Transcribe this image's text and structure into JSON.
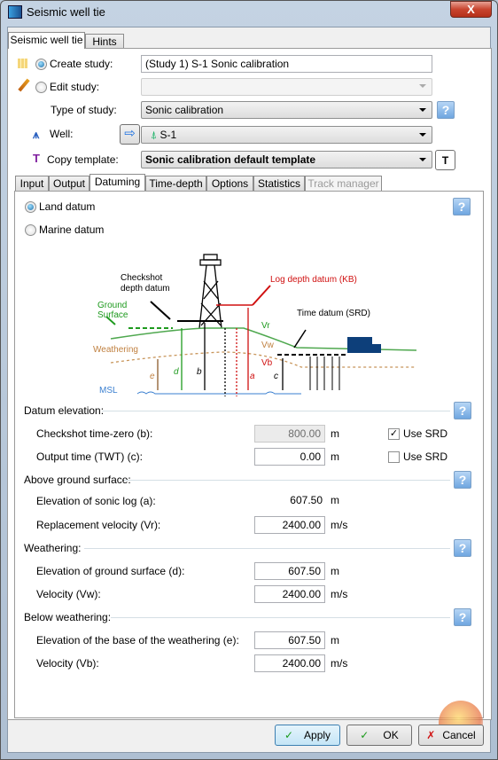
{
  "window": {
    "title": "Seismic well tie",
    "close_label": "X"
  },
  "outer_tabs": [
    {
      "label": "Seismic well tie",
      "active": true
    },
    {
      "label": "Hints",
      "active": false
    }
  ],
  "study": {
    "create_label": "Create study:",
    "create_value": "(Study 1) S-1 Sonic calibration",
    "create_selected": true,
    "edit_label": "Edit study:",
    "edit_value": "",
    "type_label": "Type of study:",
    "type_value": "Sonic calibration",
    "well_label": "Well:",
    "well_value": "S-1",
    "template_label": "Copy template:",
    "template_value": "Sonic calibration default template",
    "help_label": "?"
  },
  "inner_tabs": [
    {
      "label": "Input"
    },
    {
      "label": "Output"
    },
    {
      "label": "Datuming",
      "active": true
    },
    {
      "label": "Time-depth"
    },
    {
      "label": "Options"
    },
    {
      "label": "Statistics"
    },
    {
      "label": "Track manager",
      "disabled": true
    }
  ],
  "datum": {
    "land_label": "Land datum",
    "marine_label": "Marine datum",
    "selected": "land"
  },
  "diagram": {
    "checkshot": "Checkshot",
    "checkshot2": "depth datum",
    "ground": "Ground",
    "surface": "Surface",
    "log": "Log depth datum (KB)",
    "time": "Time datum (SRD)",
    "weathering": "Weathering",
    "msl": "MSL",
    "vr": "Vr",
    "vw": "Vw",
    "vb": "Vb",
    "a": "a",
    "b": "b",
    "c": "c",
    "d": "d",
    "e": "e"
  },
  "sections": {
    "datum_elevation": {
      "title": "Datum elevation:",
      "checkshot": {
        "label": "Checkshot time-zero (b):",
        "value": "800.00",
        "unit": "m",
        "srd_label": "Use SRD",
        "srd": true
      },
      "output": {
        "label": "Output time (TWT) (c):",
        "value": "0.00",
        "unit": "m",
        "srd_label": "Use SRD",
        "srd": false
      }
    },
    "above": {
      "title": "Above ground surface:",
      "sonic": {
        "label": "Elevation of sonic log (a):",
        "value": "607.50",
        "unit": "m"
      },
      "vr": {
        "label": "Replacement velocity (Vr):",
        "value": "2400.00",
        "unit": "m/s"
      }
    },
    "weathering": {
      "title": "Weathering:",
      "ground": {
        "label": "Elevation of ground surface (d):",
        "value": "607.50",
        "unit": "m"
      },
      "vw": {
        "label": "Velocity (Vw):",
        "value": "2400.00",
        "unit": "m/s"
      }
    },
    "below": {
      "title": "Below weathering:",
      "base": {
        "label": "Elevation of the base of the weathering (e):",
        "value": "607.50",
        "unit": "m"
      },
      "vb": {
        "label": "Velocity (Vb):",
        "value": "2400.00",
        "unit": "m/s"
      }
    }
  },
  "buttons": {
    "apply": "Apply",
    "ok": "OK",
    "cancel": "Cancel"
  },
  "colors": {
    "ground": "#1e9a1e",
    "log": "#d01010",
    "weathering": "#c08040",
    "msl": "#3a7fd0",
    "truck": "#0d3f7a"
  }
}
